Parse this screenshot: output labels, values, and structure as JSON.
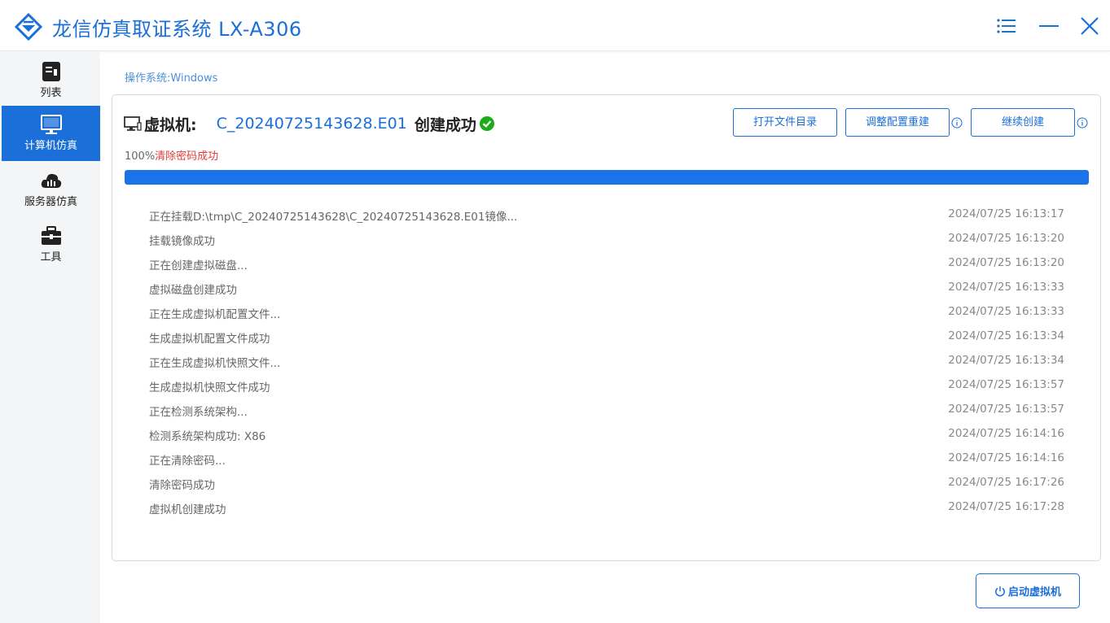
{
  "app": {
    "title": "龙信仿真取证系统 LX-A306",
    "accent": "#1a6fd8"
  },
  "window_controls": [
    {
      "name": "menu-icon"
    },
    {
      "name": "minimize-icon"
    },
    {
      "name": "close-icon"
    }
  ],
  "sidebar": {
    "items": [
      {
        "label": "列表",
        "icon": "list-icon",
        "active": false
      },
      {
        "label": "计算机仿真",
        "icon": "monitor-icon",
        "active": true
      },
      {
        "label": "服务器仿真",
        "icon": "cloud-server-icon",
        "active": false
      },
      {
        "label": "工具",
        "icon": "toolbox-icon",
        "active": false
      }
    ]
  },
  "os_line": {
    "label": "操作系统:",
    "value": "Windows"
  },
  "vm": {
    "label": "虚拟机:",
    "name": "C_20240725143628.E01",
    "status": "创建成功",
    "status_color": "#1aad19"
  },
  "buttons": {
    "open_dir": "打开文件目录",
    "reconfig": "调整配置重建",
    "continue": "继续创建",
    "start_vm": "启动虚拟机"
  },
  "progress": {
    "percent_text": "100%",
    "status_text": "清除密码成功",
    "value": 1.0
  },
  "log": [
    {
      "msg": "正在挂载D:\\tmp\\C_20240725143628\\C_20240725143628.E01镜像...",
      "time": "2024/07/25 16:13:17"
    },
    {
      "msg": "挂载镜像成功",
      "time": "2024/07/25 16:13:20"
    },
    {
      "msg": "正在创建虚拟磁盘...",
      "time": "2024/07/25 16:13:20"
    },
    {
      "msg": "虚拟磁盘创建成功",
      "time": "2024/07/25 16:13:33"
    },
    {
      "msg": "正在生成虚拟机配置文件...",
      "time": "2024/07/25 16:13:33"
    },
    {
      "msg": "生成虚拟机配置文件成功",
      "time": "2024/07/25 16:13:34"
    },
    {
      "msg": "正在生成虚拟机快照文件...",
      "time": "2024/07/25 16:13:34"
    },
    {
      "msg": "生成虚拟机快照文件成功",
      "time": "2024/07/25 16:13:57"
    },
    {
      "msg": "正在检测系统架构...",
      "time": "2024/07/25 16:13:57"
    },
    {
      "msg": "检测系统架构成功: X86",
      "time": "2024/07/25 16:14:16"
    },
    {
      "msg": "正在清除密码...",
      "time": "2024/07/25 16:14:16"
    },
    {
      "msg": "清除密码成功",
      "time": "2024/07/25 16:17:26"
    },
    {
      "msg": "虚拟机创建成功",
      "time": "2024/07/25 16:17:28"
    }
  ]
}
